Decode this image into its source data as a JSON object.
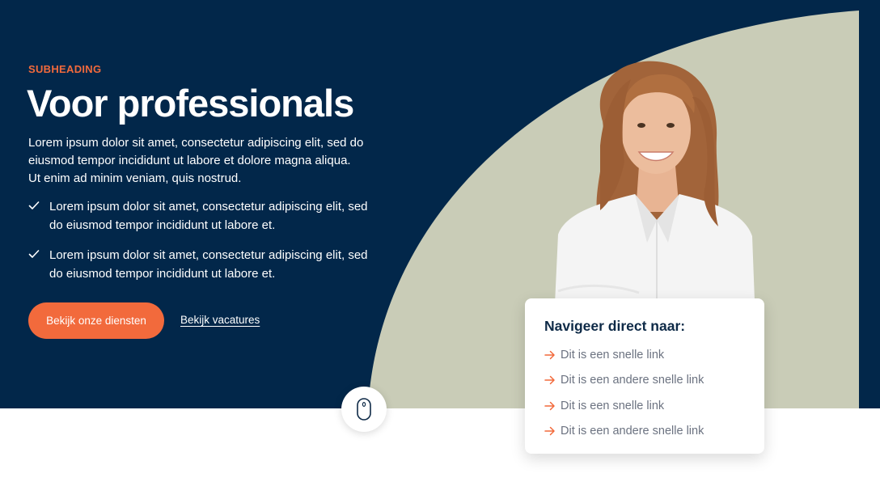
{
  "hero": {
    "subheading": "SUBHEADING",
    "title": "Voor professionals",
    "intro": "Lorem ipsum dolor sit amet, consectetur adipiscing elit, sed do eiusmod tempor incididunt ut labore et dolore magna aliqua. Ut enim ad minim veniam, quis nostrud.",
    "checklist": [
      "Lorem ipsum dolor sit amet, consectetur adipiscing elit, sed do eiusmod tempor incididunt ut labore et.",
      "Lorem ipsum dolor sit amet, consectetur adipiscing elit, sed do eiusmod tempor incididunt ut labore et."
    ],
    "primary_button": "Bekijk onze diensten",
    "secondary_link": "Bekijk vacatures"
  },
  "nav_card": {
    "title": "Navigeer direct naar:",
    "links": [
      "Dit is een snelle link",
      "Dit is een andere snelle link",
      "Dit is een snelle link",
      "Dit is een andere snelle link"
    ]
  },
  "icons": {
    "check": "check-icon",
    "arrow": "arrow-right-icon",
    "scroll": "mouse-scroll-icon"
  },
  "colors": {
    "navy": "#02274a",
    "accent": "#f26a3c",
    "sage": "#c9ccb7",
    "white": "#ffffff"
  }
}
